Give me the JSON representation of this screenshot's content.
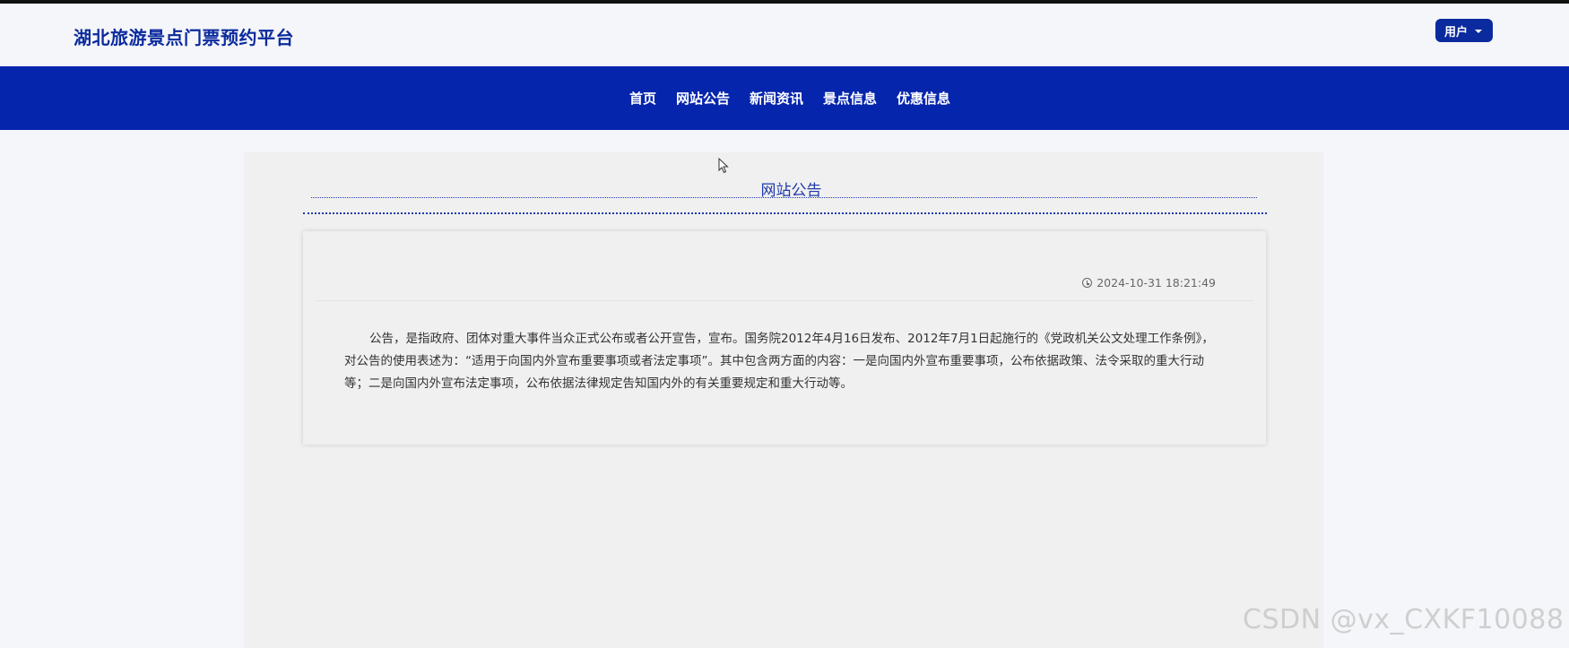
{
  "header": {
    "site_title": "湖北旅游景点门票预约平台",
    "user_menu_label": "用户"
  },
  "nav": {
    "items": [
      {
        "label": "首页"
      },
      {
        "label": "网站公告"
      },
      {
        "label": "新闻资讯"
      },
      {
        "label": "景点信息"
      },
      {
        "label": "优惠信息"
      }
    ]
  },
  "section": {
    "title": "网站公告"
  },
  "notice": {
    "timestamp": "2024-10-31 18:21:49",
    "content": "公告，是指政府、团体对重大事件当众正式公布或者公开宣告，宣布。国务院2012年4月16日发布、2012年7月1日起施行的《党政机关公文处理工作条例》，对公告的使用表述为：“适用于向国内外宣布重要事项或者法定事项”。其中包含两方面的内容：一是向国内外宣布重要事项，公布依据政策、法令采取的重大行动等；二是向国内外宣布法定事项，公布依据法律规定告知国内外的有关重要规定和重大行动等。"
  },
  "watermark": "CSDN @vx_CXKF10088",
  "colors": {
    "brand": "#0625ad",
    "title": "#0b2a9e",
    "accent": "#1e3aa8",
    "background": "#f5f6f9",
    "panel": "#f1f0f1"
  }
}
